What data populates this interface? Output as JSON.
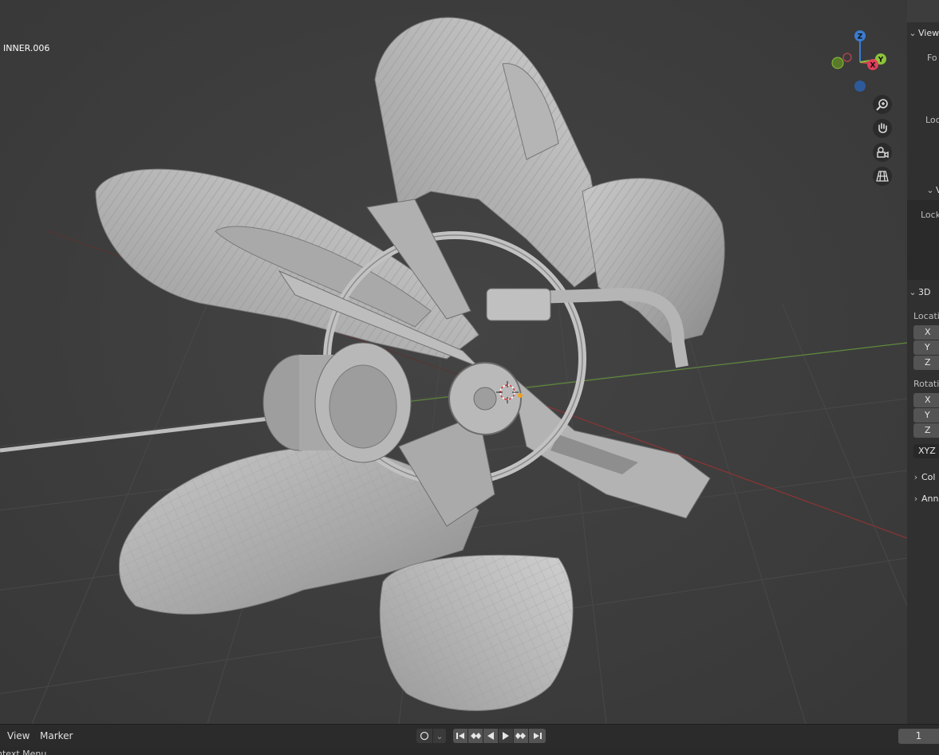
{
  "viewport": {
    "object_name": "INNER.006",
    "gizmo": {
      "z": "Z",
      "y": "Y",
      "x": "X"
    }
  },
  "nav_icons": [
    "zoom-icon",
    "hand-icon",
    "camera-icon",
    "grid-icon"
  ],
  "npanel": {
    "view_header": "View",
    "focal_label": "Fo",
    "lock_label": "Loc",
    "sub_header": "V",
    "sub_lock_label": "Lock",
    "cursor_header": "3D",
    "location_label": "Locati",
    "rotation_label": "Rotati",
    "axes_location": [
      "X",
      "Y",
      "Z"
    ],
    "axes_rotation": [
      "X",
      "Y",
      "Z"
    ],
    "rotation_mode": "XYZ",
    "collapsed_1": "Col",
    "collapsed_2": "Ann"
  },
  "timeline": {
    "menu_view": "View",
    "menu_marker": "Marker",
    "current_frame": "1"
  },
  "statusbar": {
    "text": "ntext Menu"
  }
}
